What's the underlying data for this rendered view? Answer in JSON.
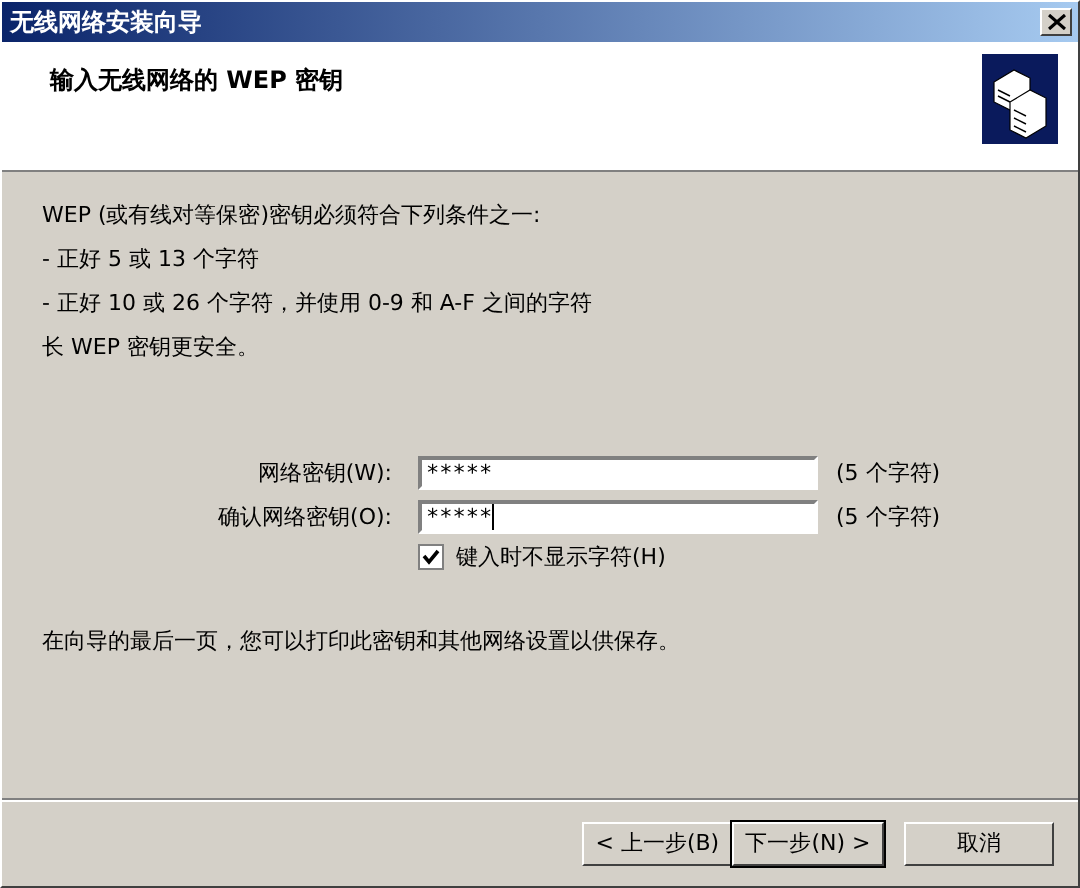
{
  "window": {
    "title": "无线网络安装向导"
  },
  "header": {
    "title": "输入无线网络的 WEP 密钥"
  },
  "intro": [
    "WEP (或有线对等保密)密钥必须符合下列条件之一:",
    "- 正好 5 或 13 个字符",
    "- 正好 10 或 26 个字符，并使用 0-9 和 A-F 之间的字符",
    "长 WEP 密钥更安全。"
  ],
  "fields": [
    {
      "label": "网络密钥(W):",
      "value": "*****",
      "hint": "(5 个字符)",
      "focused": false
    },
    {
      "label": "确认网络密钥(O):",
      "value": "*****",
      "hint": "(5 个字符)",
      "focused": true
    }
  ],
  "hide_chars": {
    "label": "键入时不显示字符(H)",
    "checked": true
  },
  "footer_note": "在向导的最后一页，您可以打印此密钥和其他网络设置以供保存。",
  "buttons": [
    {
      "label": "< 上一步(B)",
      "default": false
    },
    {
      "label": "下一步(N) >",
      "default": true
    },
    {
      "label": "取消",
      "default": false
    }
  ]
}
